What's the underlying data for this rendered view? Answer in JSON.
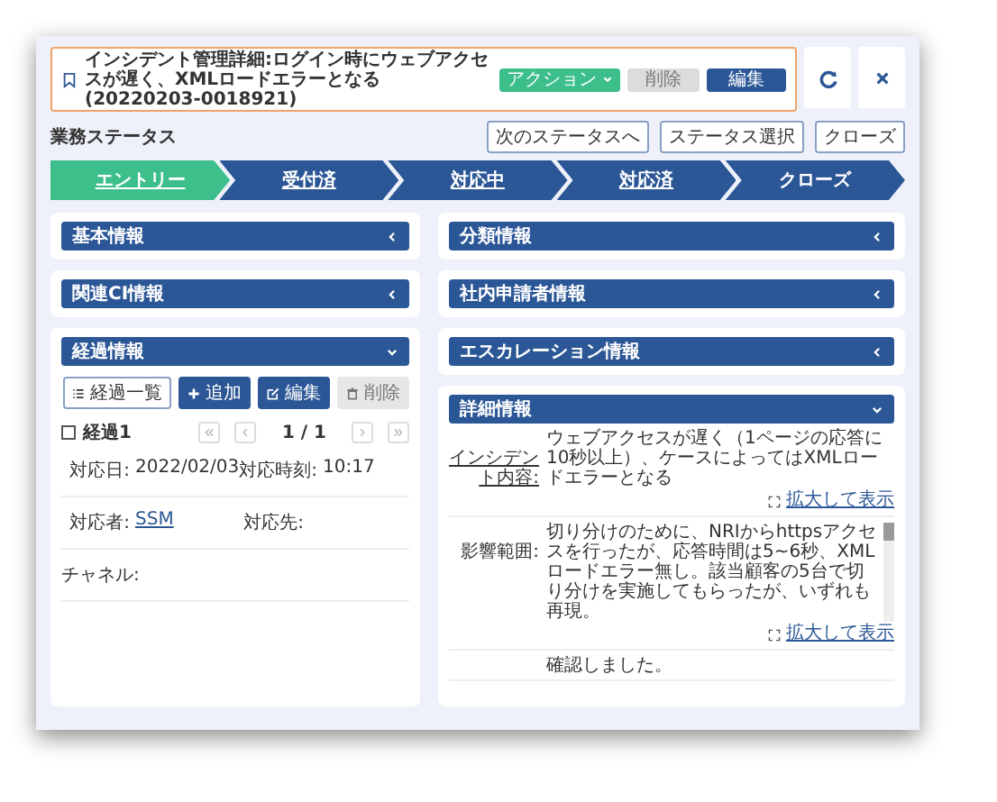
{
  "title": {
    "text": "インシデント管理詳細:ログイン時にウェブアクセスが遅く、XMLロードエラーとなる(20220203-0018921)"
  },
  "header_buttons": [
    {
      "label": "アクション",
      "kind": "dropdown"
    },
    {
      "label": "削除",
      "kind": "disabled"
    },
    {
      "label": "編集",
      "kind": "primary"
    }
  ],
  "status": {
    "label": "業務ステータス",
    "buttons": [
      "次のステータスへ",
      "ステータス選択",
      "クローズ"
    ],
    "steps": [
      {
        "label": "エントリー",
        "selected": true,
        "link": true
      },
      {
        "label": "受付済",
        "selected": false,
        "link": true
      },
      {
        "label": "対応中",
        "selected": false,
        "link": true
      },
      {
        "label": "対応済",
        "selected": false,
        "link": true
      },
      {
        "label": "クローズ",
        "selected": false,
        "link": false
      }
    ]
  },
  "sections_left": [
    {
      "title": "基本情報",
      "expanded": false
    },
    {
      "title": "関連CI情報",
      "expanded": false
    }
  ],
  "sections_right": [
    {
      "title": "分類情報",
      "expanded": false
    },
    {
      "title": "社内申請者情報",
      "expanded": false
    },
    {
      "title": "エスカレーション情報",
      "expanded": false
    }
  ],
  "progress": {
    "title": "経過情報",
    "expanded": true,
    "tools": [
      {
        "label": "経過一覧",
        "kind": "list"
      },
      {
        "label": "追加",
        "kind": "add"
      },
      {
        "label": "編集",
        "kind": "edit"
      },
      {
        "label": "削除",
        "kind": "delete"
      }
    ],
    "entry": {
      "label": "経過1",
      "checked": false
    },
    "pager": "1 / 1",
    "fields": [
      [
        {
          "label": "対応日:",
          "value": "2022/02/03"
        },
        {
          "label": "対応時刻:",
          "value": "10:17"
        }
      ],
      [
        {
          "label": "対応者:",
          "value": "SSM",
          "link": true
        },
        {
          "label": "対応先:"
        }
      ],
      [
        {
          "label": "チャネル:"
        }
      ]
    ]
  },
  "detail": {
    "title": "詳細情報",
    "expanded": true,
    "rows": [
      {
        "label": "インシデント内容:",
        "text": "ウェブアクセスが遅く（1ページの応答に10秒以上）、ケースによってはXMLロードエラーとなる",
        "link": "拡大して表示",
        "scroll": false
      },
      {
        "label": "影響範囲:",
        "text": "切り分けのために、NRIからhttpsアクセスを行ったが、応答時間は5~6秒、XMLロードエラー無し。該当顧客の5台で切り分けを実施してもらったが、いずれも再現。",
        "link": "拡大して表示",
        "scroll": true
      },
      {
        "text": "確認しました。"
      }
    ]
  }
}
